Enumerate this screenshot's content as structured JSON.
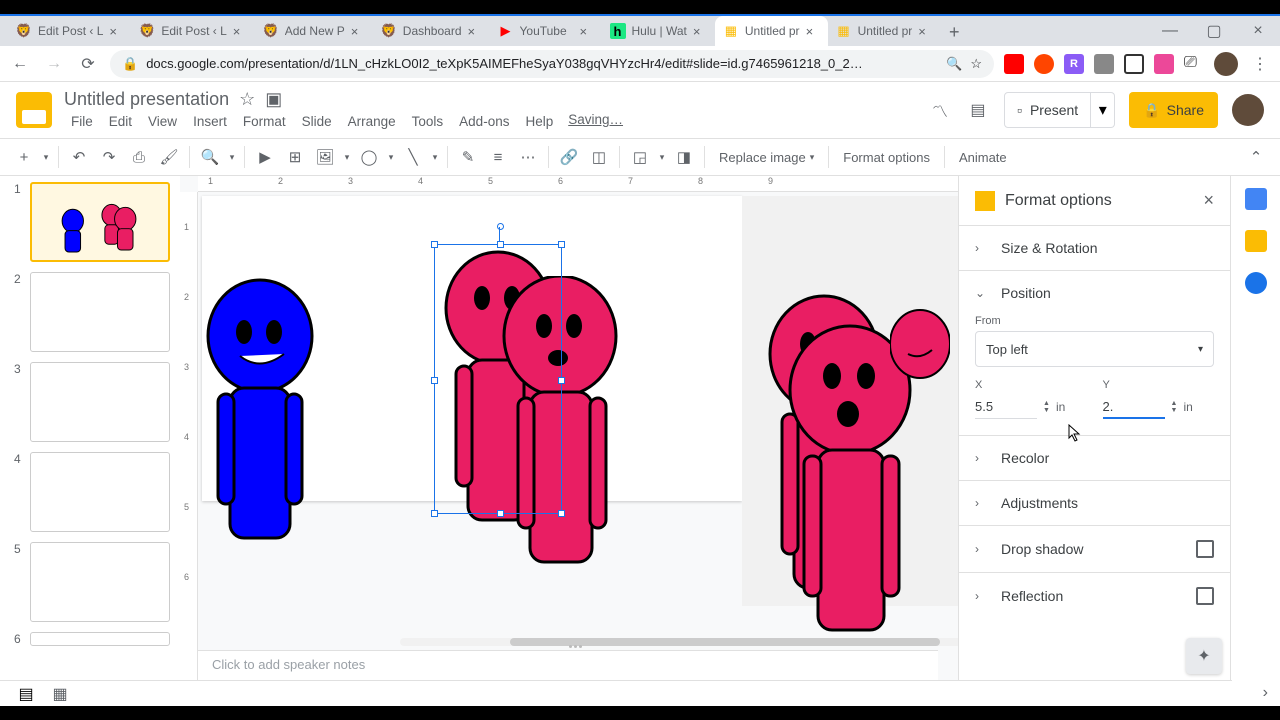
{
  "browser": {
    "tabs": [
      {
        "title": "Edit Post ‹ L",
        "favicon": "🦁"
      },
      {
        "title": "Edit Post ‹ L",
        "favicon": "🦁"
      },
      {
        "title": "Add New P",
        "favicon": "🦁"
      },
      {
        "title": "Dashboard",
        "favicon": "🦁"
      },
      {
        "title": "YouTube",
        "favicon": "▶"
      },
      {
        "title": "Hulu | Wat",
        "favicon": "h"
      },
      {
        "title": "Untitled pr",
        "favicon": "▦",
        "active": true
      },
      {
        "title": "Untitled pr",
        "favicon": "▦"
      }
    ],
    "url": "docs.google.com/presentation/d/1LN_cHzkLO0I2_teXpK5AIMEFheSyaY038gqVHYzcHr4/edit#slide=id.g7465961218_0_2…"
  },
  "doc": {
    "title": "Untitled presentation",
    "menus": [
      "File",
      "Edit",
      "View",
      "Insert",
      "Format",
      "Slide",
      "Arrange",
      "Tools",
      "Add-ons",
      "Help"
    ],
    "saving": "Saving…",
    "present": "Present",
    "share": "Share"
  },
  "toolbar": {
    "replace_image": "Replace image",
    "format_options": "Format options",
    "animate": "Animate"
  },
  "slides": [
    1,
    2,
    3,
    4,
    5,
    6
  ],
  "notes_placeholder": "Click to add speaker notes",
  "format_panel": {
    "title": "Format options",
    "sections": {
      "size_rotation": "Size & Rotation",
      "position": "Position",
      "recolor": "Recolor",
      "adjustments": "Adjustments",
      "drop_shadow": "Drop shadow",
      "reflection": "Reflection"
    },
    "position": {
      "from_label": "From",
      "from_value": "Top left",
      "x_label": "X",
      "x_value": "5.5",
      "y_label": "Y",
      "y_value": "2.",
      "unit": "in"
    }
  },
  "ruler_h": [
    "1",
    "2",
    "3",
    "4",
    "5",
    "6",
    "7",
    "8",
    "9"
  ],
  "ruler_v": [
    "1",
    "2",
    "3",
    "4",
    "5",
    "6"
  ]
}
